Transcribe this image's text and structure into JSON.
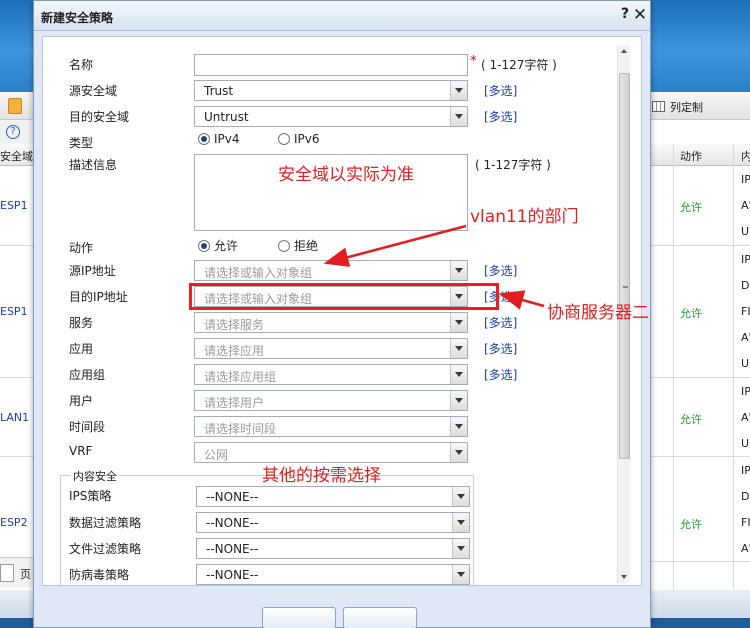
{
  "dialog": {
    "title": "新建安全策略",
    "help_symbol": "?",
    "close_symbol": "✕",
    "fields": {
      "name": {
        "label": "名称",
        "required_mark": "*",
        "hint": "( 1-127字符 )"
      },
      "src_zone": {
        "label": "源安全域",
        "value": "Trust",
        "multi": "[多选]"
      },
      "dst_zone": {
        "label": "目的安全域",
        "value": "Untrust",
        "multi": "[多选]"
      },
      "type": {
        "label": "类型",
        "options": [
          "IPv4",
          "IPv6"
        ],
        "selected": "IPv4"
      },
      "desc": {
        "label": "描述信息",
        "hint": "( 1-127字符 )"
      },
      "action": {
        "label": "动作",
        "options": [
          "允许",
          "拒绝"
        ],
        "selected": "允许"
      },
      "src_ip": {
        "label": "源IP地址",
        "placeholder": "请选择或输入对象组",
        "multi": "[多选]"
      },
      "dst_ip": {
        "label": "目的IP地址",
        "placeholder": "请选择或输入对象组",
        "multi": "[多选]"
      },
      "service": {
        "label": "服务",
        "placeholder": "请选择服务",
        "multi": "[多选]"
      },
      "app": {
        "label": "应用",
        "placeholder": "请选择应用",
        "multi": "[多选]"
      },
      "app_group": {
        "label": "应用组",
        "placeholder": "请选择应用组",
        "multi": "[多选]"
      },
      "user": {
        "label": "用户",
        "placeholder": "请选择用户"
      },
      "time_range": {
        "label": "时间段",
        "placeholder": "请选择时间段"
      },
      "vrf": {
        "label": "VRF",
        "placeholder": "公网"
      }
    },
    "content_security": {
      "legend": "内容安全",
      "ips": {
        "label": "IPS策略",
        "value": "--NONE--"
      },
      "data_filter": {
        "label": "数据过滤策略",
        "value": "--NONE--"
      },
      "file_filter": {
        "label": "文件过滤策略",
        "value": "--NONE--"
      },
      "antivirus": {
        "label": "防病毒策略",
        "value": "--NONE--"
      }
    }
  },
  "annotations": {
    "zone_note": "安全域以实际为准",
    "vlan_note": "vlan11的部门",
    "server_note": "协商服务器二",
    "other_note": "其他的按需选择",
    "color": "#e02020"
  },
  "background": {
    "toolbar_column_setting": "列定制",
    "header_zone": "安全域",
    "header_action": "动作",
    "header_content": "内",
    "page_label": "页",
    "rows": [
      {
        "zone": "ESP1",
        "action": "允许",
        "protocols": [
          "IP",
          "A'",
          "Ul"
        ]
      },
      {
        "zone": "ESP1",
        "action": "允许",
        "protocols": [
          "IP",
          "Dl",
          "FI",
          "A'",
          "Ul"
        ]
      },
      {
        "zone": "LAN1",
        "action": "允许",
        "protocols": [
          "IP",
          "A'",
          "Ul"
        ]
      },
      {
        "zone": "ESP2",
        "action": "允许",
        "protocols": [
          "IP",
          "Dl",
          "FI",
          "A'"
        ]
      }
    ]
  }
}
